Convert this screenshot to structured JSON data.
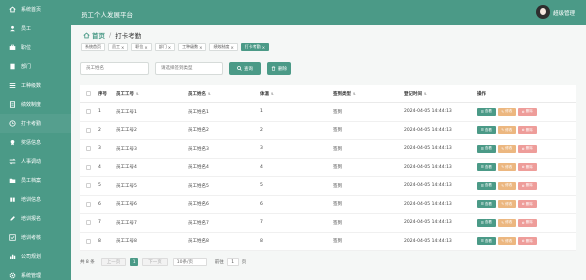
{
  "colors": {
    "primary": "#4b9a87",
    "edit": "#ecb780",
    "delete": "#ee9d9a"
  },
  "header": {
    "title": "员工个人发展平台",
    "username": "超级管理"
  },
  "sidebar": {
    "items": [
      {
        "label": "系统首页",
        "icon": "home-icon"
      },
      {
        "label": "员工",
        "icon": "user-icon"
      },
      {
        "label": "职位",
        "icon": "briefcase-icon"
      },
      {
        "label": "部门",
        "icon": "building-icon"
      },
      {
        "label": "工种级数",
        "icon": "list-icon"
      },
      {
        "label": "绩效制度",
        "icon": "document-icon"
      },
      {
        "label": "打卡考勤",
        "icon": "clock-icon"
      },
      {
        "label": "奖惩信息",
        "icon": "award-icon"
      },
      {
        "label": "人事调动",
        "icon": "swap-icon"
      },
      {
        "label": "员工档案",
        "icon": "folder-icon"
      },
      {
        "label": "培训信息",
        "icon": "book-icon"
      },
      {
        "label": "培训报名",
        "icon": "edit-icon"
      },
      {
        "label": "培训考核",
        "icon": "check-icon"
      },
      {
        "label": "公司规划",
        "icon": "chart-icon"
      },
      {
        "label": "系统管理",
        "icon": "gear-icon"
      }
    ]
  },
  "breadcrumb": {
    "home": "首页",
    "separator": "/",
    "current": "打卡考勤"
  },
  "tags": [
    {
      "label": "系统首页",
      "closable": false
    },
    {
      "label": "员工",
      "closable": true
    },
    {
      "label": "职位",
      "closable": true
    },
    {
      "label": "部门",
      "closable": true
    },
    {
      "label": "工种级数",
      "closable": true
    },
    {
      "label": "绩效制度",
      "closable": true
    },
    {
      "label": "打卡考勤",
      "closable": true,
      "active": true
    }
  ],
  "search": {
    "employee_name_placeholder": "员工姓名",
    "checkin_type_placeholder": "请选择签到类型",
    "search_label": "查询",
    "delete_label": "删除"
  },
  "table": {
    "columns": [
      "序号",
      "员工工号",
      "员工姓名",
      "体温",
      "签到类型",
      "登记时间",
      "操作"
    ],
    "rows": [
      {
        "index": "1",
        "emp_no": "员工工号1",
        "emp_name": "员工姓名1",
        "temp": "1",
        "type": "签到",
        "time": "2024-04-05 14:44:13"
      },
      {
        "index": "2",
        "emp_no": "员工工号2",
        "emp_name": "员工姓名2",
        "temp": "2",
        "type": "签到",
        "time": "2024-04-05 14:44:13"
      },
      {
        "index": "3",
        "emp_no": "员工工号3",
        "emp_name": "员工姓名3",
        "temp": "3",
        "type": "签到",
        "time": "2024-04-05 14:44:13"
      },
      {
        "index": "4",
        "emp_no": "员工工号4",
        "emp_name": "员工姓名4",
        "temp": "4",
        "type": "签到",
        "time": "2024-04-05 14:44:13"
      },
      {
        "index": "5",
        "emp_no": "员工工号5",
        "emp_name": "员工姓名5",
        "temp": "5",
        "type": "签到",
        "time": "2024-04-05 14:44:13"
      },
      {
        "index": "6",
        "emp_no": "员工工号6",
        "emp_name": "员工姓名6",
        "temp": "6",
        "type": "签到",
        "time": "2024-04-05 14:44:13"
      },
      {
        "index": "7",
        "emp_no": "员工工号7",
        "emp_name": "员工姓名7",
        "temp": "7",
        "type": "签到",
        "time": "2024-04-05 14:44:13"
      },
      {
        "index": "8",
        "emp_no": "员工工号8",
        "emp_name": "员工姓名8",
        "temp": "8",
        "type": "签到",
        "time": "2024-04-05 14:44:13"
      }
    ],
    "actions": {
      "view": "查看",
      "edit": "修改",
      "delete": "删除"
    }
  },
  "pagination": {
    "total": "共 8 条",
    "prev": "上一页",
    "current": "1",
    "next": "下一页",
    "page_size": "10条/页",
    "goto_label": "前往",
    "goto_value": "1",
    "page_suffix": "页"
  }
}
